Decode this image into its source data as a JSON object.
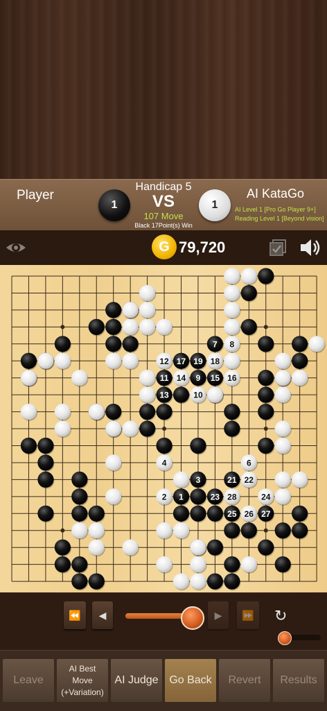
{
  "header": {
    "player_name": "Player",
    "handicap": "Handicap 5",
    "vs": "VS",
    "move_count": "107 Move",
    "result": "Black 17Point(s) Win",
    "ai_name": "AI KataGo",
    "ai_level": "AI Level 1 [Pro Go Player 9+]",
    "reading_level": "Reading Level 1 [Beyond vision]",
    "black_captures": "1",
    "white_captures": "1"
  },
  "status": {
    "coins": "79,720",
    "coin_symbol": "G",
    "icons": [
      "eye-icon",
      "checkbox-icon",
      "speaker-icon"
    ]
  },
  "board": {
    "size": 19,
    "colors": {
      "black": "#111111",
      "white": "#f2f2f2",
      "line": "#3a2a1a"
    },
    "black": [
      [
        15,
        0
      ],
      [
        14,
        1
      ],
      [
        6,
        2
      ],
      [
        7,
        2
      ],
      [
        5,
        3
      ],
      [
        6,
        3
      ],
      [
        14,
        3
      ],
      [
        6,
        4
      ],
      [
        7,
        4
      ],
      [
        3,
        4
      ],
      [
        15,
        4
      ],
      [
        17,
        4
      ],
      [
        1,
        5
      ],
      [
        2,
        5
      ],
      [
        12,
        5
      ],
      [
        17,
        5
      ],
      [
        1,
        6
      ],
      [
        10,
        6
      ],
      [
        11,
        6
      ],
      [
        15,
        6
      ],
      [
        16,
        6
      ],
      [
        9,
        7
      ],
      [
        10,
        7
      ],
      [
        11,
        7
      ],
      [
        12,
        7
      ],
      [
        15,
        7
      ],
      [
        5,
        8
      ],
      [
        6,
        8
      ],
      [
        8,
        8
      ],
      [
        9,
        8
      ],
      [
        13,
        8
      ],
      [
        15,
        8
      ],
      [
        6,
        9
      ],
      [
        8,
        9
      ],
      [
        13,
        9
      ],
      [
        1,
        10
      ],
      [
        2,
        10
      ],
      [
        9,
        10
      ],
      [
        11,
        10
      ],
      [
        15,
        10
      ],
      [
        2,
        11
      ],
      [
        2,
        12
      ],
      [
        4,
        12
      ],
      [
        4,
        13
      ],
      [
        11,
        13
      ],
      [
        13,
        13
      ],
      [
        2,
        14
      ],
      [
        4,
        14
      ],
      [
        5,
        14
      ],
      [
        10,
        14
      ],
      [
        11,
        14
      ],
      [
        12,
        14
      ],
      [
        17,
        14
      ],
      [
        13,
        15
      ],
      [
        14,
        15
      ],
      [
        16,
        15
      ],
      [
        17,
        15
      ],
      [
        3,
        16
      ],
      [
        11,
        16
      ],
      [
        12,
        16
      ],
      [
        15,
        16
      ],
      [
        3,
        17
      ],
      [
        4,
        17
      ],
      [
        13,
        17
      ],
      [
        16,
        17
      ],
      [
        4,
        18
      ],
      [
        5,
        18
      ],
      [
        12,
        18
      ],
      [
        13,
        18
      ],
      [
        11,
        19
      ]
    ],
    "white": [
      [
        13,
        0
      ],
      [
        14,
        0
      ],
      [
        8,
        1
      ],
      [
        13,
        1
      ],
      [
        7,
        2
      ],
      [
        8,
        2
      ],
      [
        13,
        2
      ],
      [
        7,
        3
      ],
      [
        8,
        3
      ],
      [
        9,
        3
      ],
      [
        13,
        3
      ],
      [
        18,
        4
      ],
      [
        2,
        5
      ],
      [
        3,
        5
      ],
      [
        6,
        5
      ],
      [
        7,
        5
      ],
      [
        13,
        5
      ],
      [
        16,
        5
      ],
      [
        1,
        6
      ],
      [
        4,
        6
      ],
      [
        8,
        6
      ],
      [
        16,
        6
      ],
      [
        17,
        6
      ],
      [
        13,
        6
      ],
      [
        8,
        7
      ],
      [
        12,
        7
      ],
      [
        16,
        7
      ],
      [
        1,
        8
      ],
      [
        3,
        8
      ],
      [
        5,
        8
      ],
      [
        3,
        9
      ],
      [
        6,
        9
      ],
      [
        7,
        9
      ],
      [
        16,
        9
      ],
      [
        16,
        10
      ],
      [
        6,
        11
      ],
      [
        9,
        11
      ],
      [
        10,
        12
      ],
      [
        16,
        12
      ],
      [
        17,
        12
      ],
      [
        6,
        13
      ],
      [
        16,
        13
      ],
      [
        4,
        15
      ],
      [
        5,
        15
      ],
      [
        9,
        15
      ],
      [
        10,
        15
      ],
      [
        5,
        16
      ],
      [
        7,
        16
      ],
      [
        11,
        16
      ],
      [
        9,
        17
      ],
      [
        11,
        17
      ],
      [
        14,
        17
      ],
      [
        10,
        18
      ],
      [
        11,
        18
      ],
      [
        10,
        19
      ]
    ],
    "marked": [
      {
        "c": 9,
        "r": 11,
        "color": "white",
        "n": "4"
      },
      {
        "c": 14,
        "r": 11,
        "color": "white",
        "n": "6"
      },
      {
        "c": 11,
        "r": 12,
        "color": "black",
        "n": "3"
      },
      {
        "c": 13,
        "r": 12,
        "color": "black",
        "n": "21"
      },
      {
        "c": 14,
        "r": 12,
        "color": "white",
        "n": "22"
      },
      {
        "c": 9,
        "r": 13,
        "color": "white",
        "n": "2"
      },
      {
        "c": 10,
        "r": 13,
        "color": "black",
        "n": "1"
      },
      {
        "c": 12,
        "r": 13,
        "color": "black",
        "n": "23"
      },
      {
        "c": 13,
        "r": 13,
        "color": "white",
        "n": "28"
      },
      {
        "c": 15,
        "r": 13,
        "color": "white",
        "n": "24"
      },
      {
        "c": 13,
        "r": 14,
        "color": "black",
        "n": "25"
      },
      {
        "c": 14,
        "r": 14,
        "color": "white",
        "n": "26"
      },
      {
        "c": 15,
        "r": 14,
        "color": "black",
        "n": "27"
      },
      {
        "c": 12,
        "r": 4,
        "color": "black",
        "n": "7"
      },
      {
        "c": 13,
        "r": 4,
        "color": "white",
        "n": "8"
      },
      {
        "c": 9,
        "r": 5,
        "color": "white",
        "n": "12"
      },
      {
        "c": 10,
        "r": 5,
        "color": "black",
        "n": "17"
      },
      {
        "c": 11,
        "r": 5,
        "color": "black",
        "n": "19"
      },
      {
        "c": 12,
        "r": 5,
        "color": "white",
        "n": "18"
      },
      {
        "c": 9,
        "r": 6,
        "color": "black",
        "n": "11"
      },
      {
        "c": 10,
        "r": 6,
        "color": "white",
        "n": "14"
      },
      {
        "c": 11,
        "r": 6,
        "color": "black",
        "n": "9"
      },
      {
        "c": 12,
        "r": 6,
        "color": "black",
        "n": "15"
      },
      {
        "c": 13,
        "r": 6,
        "color": "white",
        "n": "16"
      },
      {
        "c": 9,
        "r": 7,
        "color": "black",
        "n": "13"
      },
      {
        "c": 11,
        "r": 7,
        "color": "white",
        "n": "10"
      }
    ]
  },
  "controls": {
    "rewind": "⏪",
    "prev": "◀",
    "next": "▶",
    "fast_forward": "⏩",
    "refresh": "↻",
    "progress": 1.0
  },
  "bottom_tabs": [
    {
      "label": "Leave"
    },
    {
      "label": "AI Best Move (+Variation)"
    },
    {
      "label": "AI Judge"
    },
    {
      "label": "Go Back"
    },
    {
      "label": "Revert"
    },
    {
      "label": "Results"
    }
  ]
}
